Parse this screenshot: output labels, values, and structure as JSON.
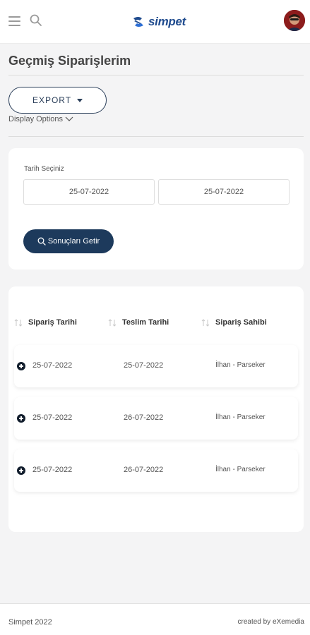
{
  "header": {
    "brand": "simpet",
    "colors": {
      "brand": "#1f4b8e",
      "button_dark": "#1d3a5c"
    }
  },
  "page": {
    "title": "Geçmiş Siparişlerim",
    "export_label": "EXPORT",
    "display_options_label": "Display Options"
  },
  "filter": {
    "date_label": "Tarih Seçiniz",
    "start_date": "25-07-2022",
    "end_date": "25-07-2022",
    "fetch_label": "Sonuçları Getir"
  },
  "table": {
    "headers": [
      "Sipariş Tarihi",
      "Teslim Tarihi",
      "Sipariş Sahibi"
    ],
    "rows": [
      [
        "25-07-2022",
        "25-07-2022",
        "İlhan - Parseker"
      ],
      [
        "25-07-2022",
        "26-07-2022",
        "İlhan - Parseker"
      ],
      [
        "25-07-2022",
        "26-07-2022",
        "İlhan - Parseker"
      ]
    ]
  },
  "footer": {
    "left": "Simpet 2022",
    "right": "created by eXemedia"
  },
  "icons": [
    "menu-icon",
    "search-icon",
    "simpet-logo-icon",
    "avatar",
    "caret-down-icon",
    "chevron-down-icon",
    "sort-icon",
    "expand-plus-icon"
  ]
}
